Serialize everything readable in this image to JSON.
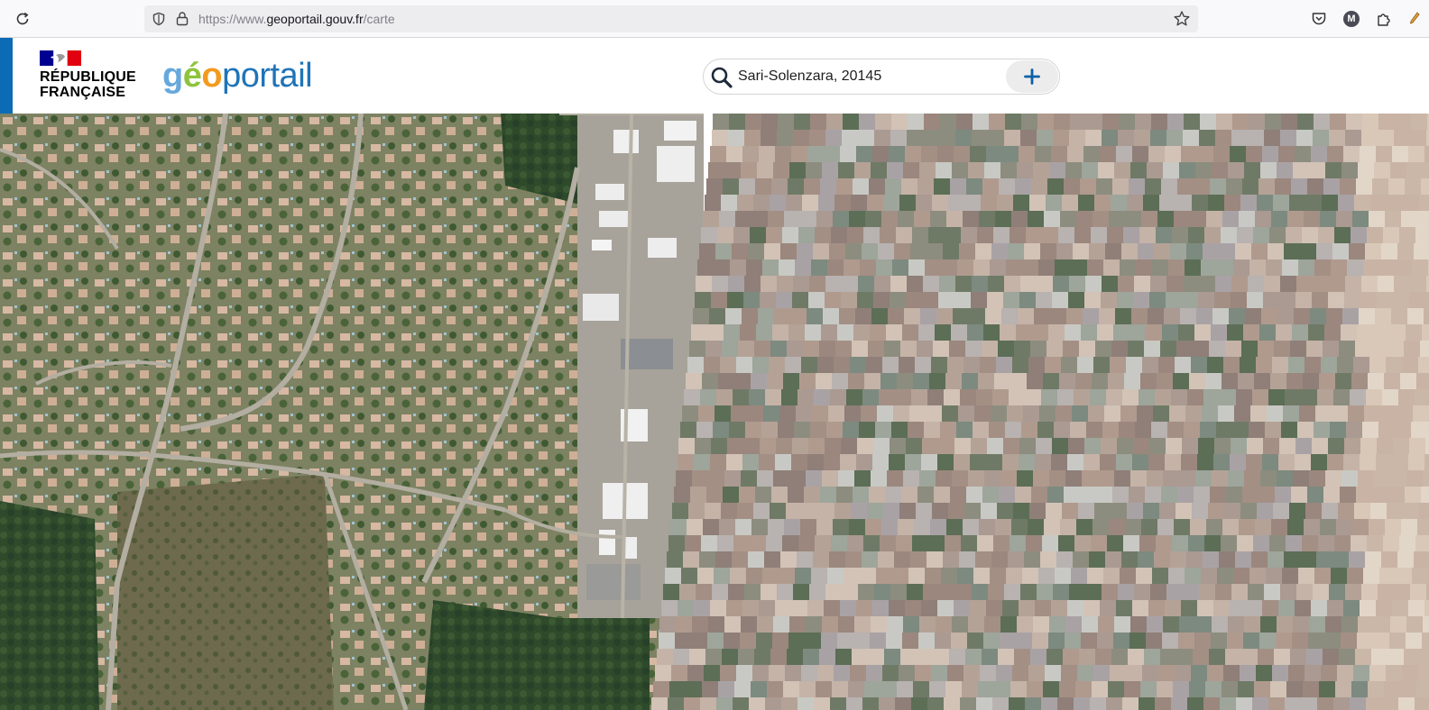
{
  "browser": {
    "url_prefix": "https://www.",
    "url_domain": "geoportail.gouv.fr",
    "url_path": "/carte",
    "avatar_letter": "M"
  },
  "header": {
    "republic_line1": "RÉPUBLIQUE",
    "republic_line2": "FRANÇAISE",
    "logo_part1": "g",
    "logo_part2": "é",
    "logo_part3": "o",
    "logo_part4": "portail"
  },
  "search": {
    "value": "Sari-Solenzara, 20145"
  },
  "colors": {
    "brand_blue": "#0b6bb5",
    "logo_blue": "#1f74b8",
    "logo_green": "#8dc43c",
    "logo_orange": "#f39a1e"
  },
  "icons": {
    "reload": "reload-icon",
    "shield": "shield-icon",
    "lock": "lock-icon",
    "star": "star-icon",
    "pocket": "pocket-icon",
    "extensions": "puzzle-icon",
    "search": "magnifier-icon",
    "add": "plus-icon"
  }
}
